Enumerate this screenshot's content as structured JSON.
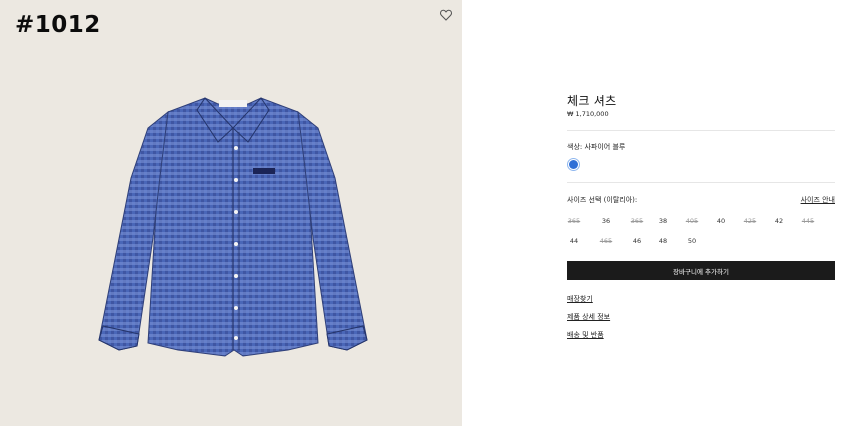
{
  "gallery": {
    "item_tag": "#1012",
    "wishlist_icon": "heart-icon",
    "background": "#ece8e1"
  },
  "product": {
    "title": "체크 셔츠",
    "price": "₩ 1,710,000",
    "color_label": "색상: 사파이어 블루",
    "swatch_color": "#2f6fd6",
    "size_label": "사이즈 선택 (이탈리아):",
    "size_guide": "사이즈 안내",
    "sizes": [
      {
        "label": "365",
        "available": false
      },
      {
        "label": "36",
        "available": true
      },
      {
        "label": "365",
        "available": false
      },
      {
        "label": "38",
        "available": true
      },
      {
        "label": "405",
        "available": false
      },
      {
        "label": "40",
        "available": true
      },
      {
        "label": "425",
        "available": false
      },
      {
        "label": "42",
        "available": true
      },
      {
        "label": "445",
        "available": false
      },
      {
        "label": "44",
        "available": true
      },
      {
        "label": "465",
        "available": false
      },
      {
        "label": "46",
        "available": true
      },
      {
        "label": "48",
        "available": true
      },
      {
        "label": "50",
        "available": true
      }
    ],
    "add_to_cart": "장바구니에 추가하기",
    "links": [
      "매장찾기",
      "제품 상세 정보",
      "배송 및 반품"
    ]
  }
}
